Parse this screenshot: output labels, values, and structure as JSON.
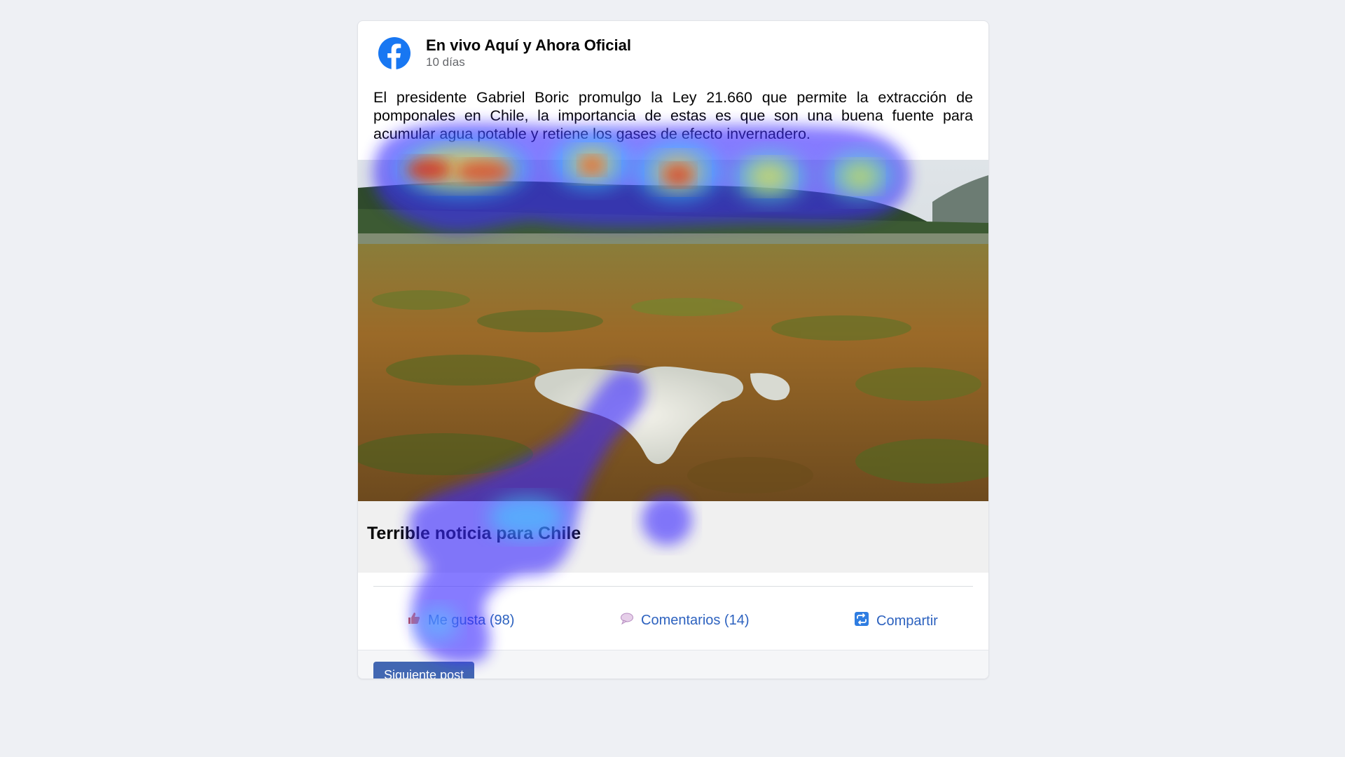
{
  "post": {
    "page_name": "En vivo Aquí y Ahora Oficial",
    "time_ago": "10 días",
    "text": "El presidente Gabriel Boric promulgo la Ley 21.660 que permite la extracción de pomponales en Chile, la importancia de estas es que son una buena fuente para acumular agua potable y retiene los gases de efecto invernadero.",
    "link_title": "Terrible noticia para Chile"
  },
  "actions": {
    "like_label": "Me gusta (98)",
    "comment_label": "Comentarios (14)",
    "share_label": "Compartir"
  },
  "footer": {
    "next_button_label": "Siguiente post"
  },
  "icons": {
    "logo": "facebook-logo-icon",
    "like": "thumbs-up-icon",
    "comment": "speech-bubble-icon",
    "share": "share-icon"
  },
  "colors": {
    "facebook_blue": "#1877f2",
    "action_text": "#2d62bf",
    "button_bg": "#4267b2",
    "page_bg": "#eef0f4"
  }
}
